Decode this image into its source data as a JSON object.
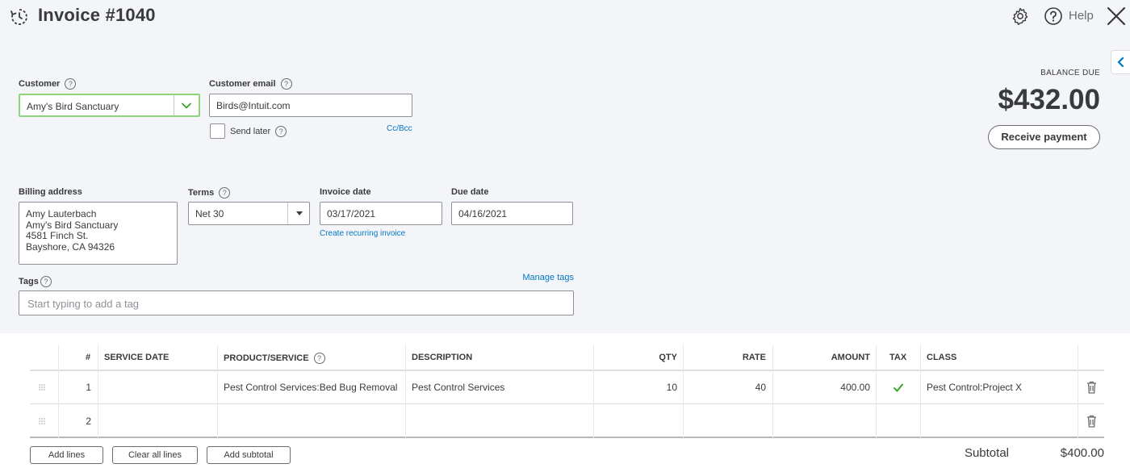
{
  "header": {
    "title": "Invoice #1040",
    "help_label": "Help",
    "icons": [
      "history-icon",
      "gear-icon",
      "help-icon",
      "close-icon",
      "chevron-left-icon"
    ]
  },
  "customer": {
    "label": "Customer",
    "value": "Amy's Bird Sanctuary"
  },
  "email": {
    "label": "Customer email",
    "value": "Birds@Intuit.com",
    "send_later_label": "Send later",
    "send_later_checked": false,
    "cc_bcc": "Cc/Bcc"
  },
  "balance": {
    "label": "BALANCE DUE",
    "amount": "$432.00",
    "receive_payment": "Receive payment"
  },
  "billing": {
    "label": "Billing address",
    "lines": [
      "Amy Lauterbach",
      "Amy's Bird Sanctuary",
      "4581 Finch St.",
      "Bayshore, CA  94326"
    ]
  },
  "terms": {
    "label": "Terms",
    "value": "Net 30"
  },
  "invoice_date": {
    "label": "Invoice date",
    "value": "03/17/2021",
    "recurring_link": "Create recurring invoice"
  },
  "due_date": {
    "label": "Due date",
    "value": "04/16/2021"
  },
  "tags": {
    "label": "Tags",
    "manage": "Manage tags",
    "placeholder": "Start typing to add a tag"
  },
  "table": {
    "headers": {
      "num": "#",
      "service_date": "SERVICE DATE",
      "product": "PRODUCT/SERVICE",
      "description": "DESCRIPTION",
      "qty": "QTY",
      "rate": "RATE",
      "amount": "AMOUNT",
      "tax": "TAX",
      "class": "CLASS"
    },
    "rows": [
      {
        "num": "1",
        "service_date": "",
        "product": "Pest Control Services:Bed Bug Removal",
        "description": "Pest Control Services",
        "qty": "10",
        "rate": "40",
        "amount": "400.00",
        "tax": true,
        "class": "Pest Control:Project X"
      },
      {
        "num": "2",
        "service_date": "",
        "product": "",
        "description": "",
        "qty": "",
        "rate": "",
        "amount": "",
        "tax": false,
        "class": ""
      }
    ]
  },
  "footer": {
    "add_lines": "Add lines",
    "clear_lines": "Clear all lines",
    "add_subtotal": "Add subtotal",
    "subtotal_label": "Subtotal",
    "subtotal_value": "$400.00"
  },
  "colors": {
    "link": "#0077c5",
    "tax_check": "#2ca01c",
    "customer_border": "#8fd37f",
    "top_bg": "#f4f5f8"
  }
}
